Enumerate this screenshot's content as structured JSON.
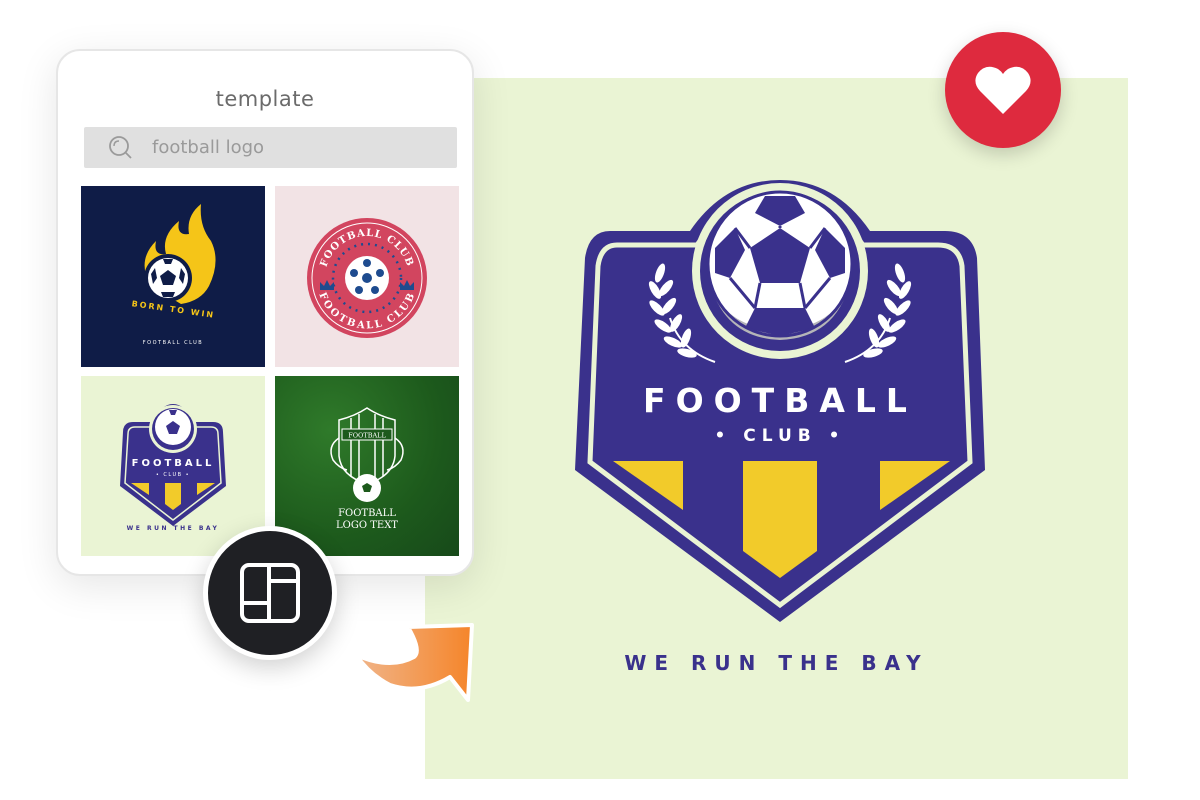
{
  "card": {
    "title": "template",
    "search": {
      "icon": "search-icon",
      "value": "football logo"
    },
    "templates": [
      {
        "name": "born-to-win",
        "headline": "BORN TO WIN",
        "subline": "FOOTBALL CLUB",
        "bg": "#0f1c47",
        "accent": "#f5c518"
      },
      {
        "name": "football-club-badge",
        "headline": "FOOTBALL CLUB",
        "subline": "FOOTBALL CLUB",
        "bg": "#f2e3e5",
        "accent": "#d2455f"
      },
      {
        "name": "we-run-the-bay",
        "headline": "FOOTBALL",
        "subline": "• CLUB •",
        "tagline": "WE RUN THE BAY",
        "bg": "#eaf4d4",
        "accent": "#3a318c"
      },
      {
        "name": "football-logo-text",
        "headline": "FOOTBALL",
        "line1": "FOOTBALL",
        "line2": "LOGO TEXT",
        "bg": "#1d5a1c",
        "accent": "#ffffff"
      }
    ]
  },
  "layout_button": {
    "icon": "layout-grid-icon"
  },
  "arrow": {
    "icon": "curved-arrow-icon",
    "color": "#f28c38"
  },
  "favorite_button": {
    "icon": "heart-icon",
    "color": "#de2a3e"
  },
  "preview": {
    "headline": "FOOTBALL",
    "subline": "• CLUB •",
    "tagline": "WE RUN THE BAY",
    "colors": {
      "background": "#eaf4d4",
      "shield": "#3a318c",
      "stripe": "#f2cb2a",
      "text": "#ffffff"
    }
  }
}
